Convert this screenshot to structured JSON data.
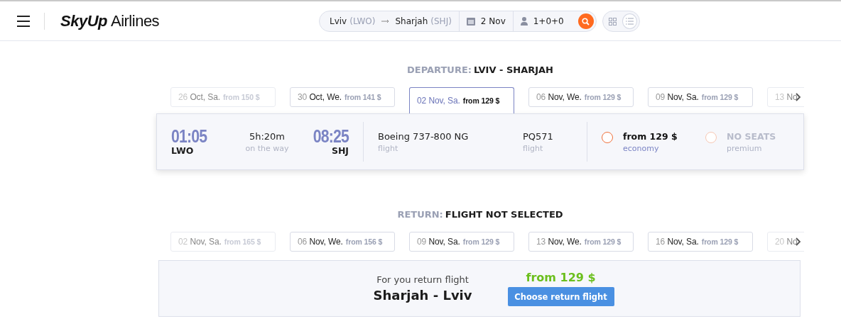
{
  "header": {
    "logo_bold": "SkyUp",
    "logo_rest": "Airlines"
  },
  "search": {
    "origin": "Lviv",
    "origin_code": "(LWO)",
    "destination": "Sharjah",
    "destination_code": "(SHJ)",
    "date": "2 Nov",
    "passengers": "1+0+0"
  },
  "view_toggle": [
    {
      "kind": "grid",
      "selected": false
    },
    {
      "kind": "list",
      "selected": true
    }
  ],
  "departure": {
    "label": "DEPARTURE:",
    "route": "LVIV - SHARJAH",
    "dates": [
      {
        "day": "26",
        "rest": "Oct, Sa.",
        "price": "from 150 $",
        "selected": false,
        "faded": true
      },
      {
        "day": "30",
        "rest": "Oct, We.",
        "price": "from 141 $",
        "selected": false,
        "faded": false
      },
      {
        "day": "02",
        "rest": "Nov, Sa.",
        "price": "from 129 $",
        "selected": true,
        "faded": false
      },
      {
        "day": "06",
        "rest": "Nov, We.",
        "price": "from 129 $",
        "selected": false,
        "faded": false
      },
      {
        "day": "09",
        "rest": "Nov, Sa.",
        "price": "from 129 $",
        "selected": false,
        "faded": false
      },
      {
        "day": "13",
        "rest": "No",
        "selected": false,
        "faded": true
      }
    ],
    "flight": {
      "dep_time": "01:05",
      "dep_code": "LWO",
      "duration": "5h:20m",
      "duration_label": "on the way",
      "arr_time": "08:25",
      "arr_code": "SHJ",
      "aircraft": "Boeing 737-800 NG",
      "aircraft_label": "flight",
      "number": "PQ571",
      "number_label": "flight",
      "fares": [
        {
          "title": "from 129 $",
          "subtitle": "economy",
          "available": true,
          "selected": false
        },
        {
          "title": "NO SEATS",
          "subtitle": "premium",
          "available": false,
          "selected": false
        }
      ]
    }
  },
  "return": {
    "label": "RETURN:",
    "route": "FLIGHT NOT SELECTED",
    "dates": [
      {
        "day": "02",
        "rest": "Nov, Sa.",
        "price": "from 165 $",
        "selected": false,
        "faded": true
      },
      {
        "day": "06",
        "rest": "Nov, We.",
        "price": "from 156 $",
        "selected": false,
        "faded": false
      },
      {
        "day": "09",
        "rest": "Nov, Sa.",
        "price": "from 129 $",
        "selected": false,
        "faded": false
      },
      {
        "day": "13",
        "rest": "Nov, We.",
        "price": "from 129 $",
        "selected": false,
        "faded": false
      },
      {
        "day": "16",
        "rest": "Nov, Sa.",
        "price": "from 129 $",
        "selected": false,
        "faded": false
      },
      {
        "day": "20",
        "rest": "No",
        "selected": false,
        "faded": true
      }
    ],
    "prompt": "For you return flight",
    "route_name": "Sharjah - Lviv",
    "price": "from 129 $",
    "button": "Choose return flight"
  }
}
